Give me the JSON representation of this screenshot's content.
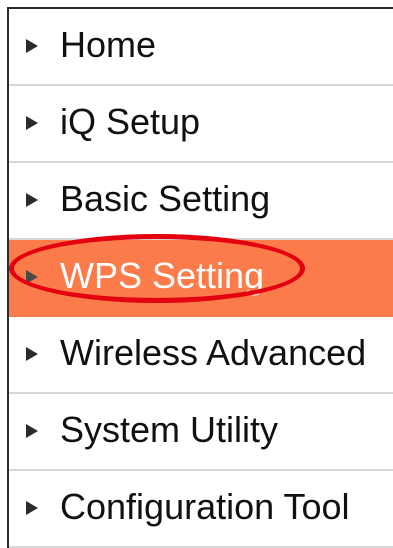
{
  "menu": {
    "items": [
      {
        "label": "Home",
        "active": false
      },
      {
        "label": "iQ Setup",
        "active": false
      },
      {
        "label": "Basic Setting",
        "active": false
      },
      {
        "label": "WPS Setting",
        "active": true
      },
      {
        "label": "Wireless Advanced",
        "active": false
      },
      {
        "label": "System Utility",
        "active": false
      },
      {
        "label": "Configuration Tool",
        "active": false
      }
    ]
  },
  "icons": {
    "item_arrow": "caret-right-icon",
    "annotation": "red-ellipse-highlight"
  },
  "colors": {
    "active_background": "#fb7b4b",
    "highlight_stroke": "#e3000f",
    "text": "#111111"
  }
}
